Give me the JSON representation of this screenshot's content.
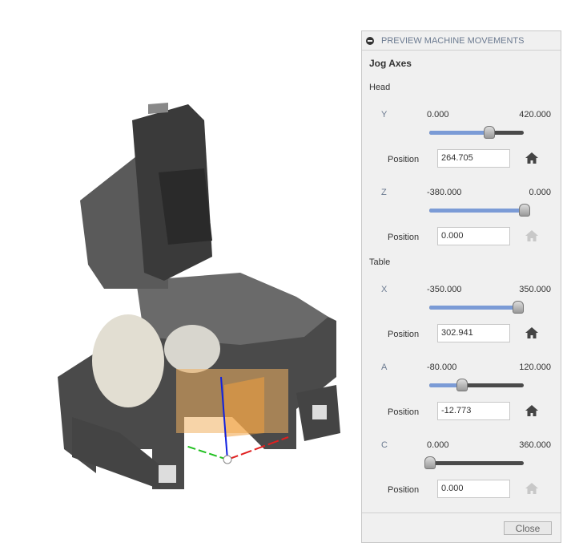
{
  "panel": {
    "title": "PREVIEW MACHINE MOVEMENTS",
    "section": "Jog Axes",
    "close_label": "Close",
    "position_label": "Position",
    "groups": [
      {
        "label": "Head",
        "axes": [
          {
            "name": "Y",
            "min": "0.000",
            "max": "420.000",
            "position": "264.705",
            "fraction": 0.63,
            "home_enabled": true
          },
          {
            "name": "Z",
            "min": "-380.000",
            "max": "0.000",
            "position": "0.000",
            "fraction": 1.0,
            "home_enabled": false
          }
        ]
      },
      {
        "label": "Table",
        "axes": [
          {
            "name": "X",
            "min": "-350.000",
            "max": "350.000",
            "position": "302.941",
            "fraction": 0.93,
            "home_enabled": true
          },
          {
            "name": "A",
            "min": "-80.000",
            "max": "120.000",
            "position": "-12.773",
            "fraction": 0.34,
            "home_enabled": true
          },
          {
            "name": "C",
            "min": "0.000",
            "max": "360.000",
            "position": "0.000",
            "fraction": 0.0,
            "home_enabled": false
          }
        ]
      }
    ]
  },
  "colors": {
    "slider_fill": "#7b9bd6",
    "slider_track": "#4a4a4a",
    "home_on": "#444444",
    "home_off": "#c8c8c8"
  }
}
